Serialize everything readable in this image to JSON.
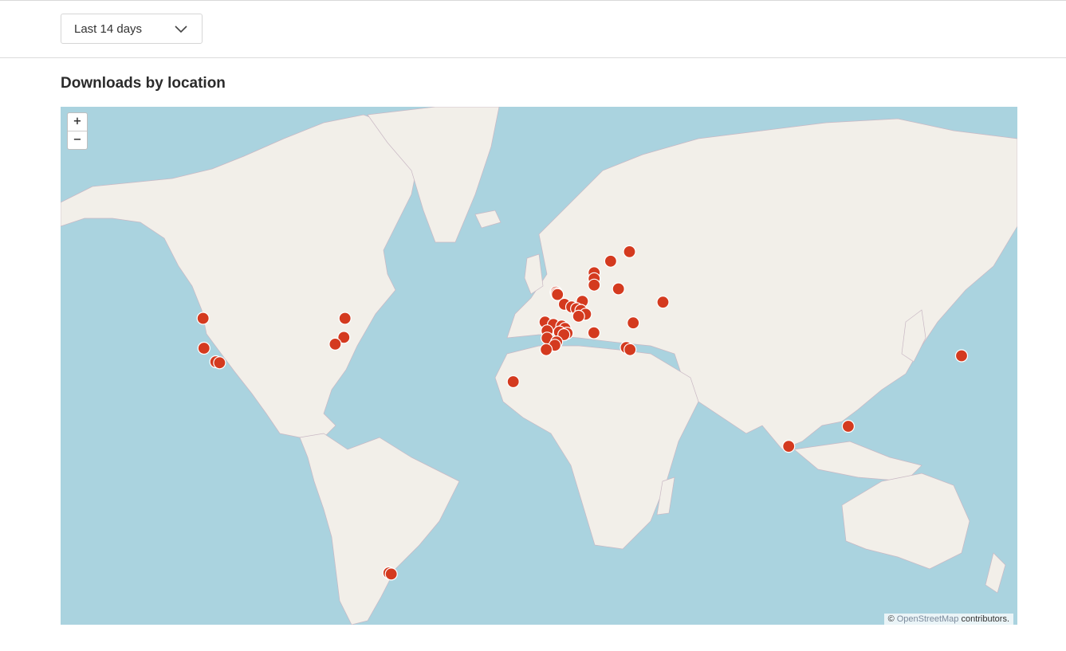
{
  "filter": {
    "selected_label": "Last 14 days",
    "chevron_icon": "chevron-down-icon"
  },
  "section": {
    "title": "Downloads by location"
  },
  "map": {
    "zoom_in_label": "+",
    "zoom_out_label": "−",
    "attribution": {
      "prefix": "©",
      "link_text": "OpenStreetMap",
      "suffix": "contributors."
    },
    "colors": {
      "water": "#aad3df",
      "land": "#f2efe9",
      "marker": "#d43a1f"
    },
    "locations": [
      {
        "lat": 49.3,
        "lon": 36.4
      },
      {
        "lat": 59.4,
        "lon": 24.8
      },
      {
        "lat": 57.7,
        "lon": 18.3
      },
      {
        "lat": 55.5,
        "lon": 12.6
      },
      {
        "lat": 54.3,
        "lon": 12.6
      },
      {
        "lat": 53.0,
        "lon": 12.6
      },
      {
        "lat": 52.2,
        "lon": 21.0
      },
      {
        "lat": 51.5,
        "lon": -0.6
      },
      {
        "lat": 51.2,
        "lon": -0.4
      },
      {
        "lat": 51.0,
        "lon": -0.1
      },
      {
        "lat": 49.5,
        "lon": 8.5
      },
      {
        "lat": 48.8,
        "lon": 2.3
      },
      {
        "lat": 48.2,
        "lon": 4.8
      },
      {
        "lat": 47.8,
        "lon": 6.5
      },
      {
        "lat": 47.4,
        "lon": 8.0
      },
      {
        "lat": 46.5,
        "lon": 9.6
      },
      {
        "lat": 46.0,
        "lon": 7.2
      },
      {
        "lat": 44.6,
        "lon": -4.4
      },
      {
        "lat": 44.0,
        "lon": -1.5
      },
      {
        "lat": 43.6,
        "lon": 1.4
      },
      {
        "lat": 43.0,
        "lon": 2.5
      },
      {
        "lat": 42.4,
        "lon": -3.7
      },
      {
        "lat": 42.1,
        "lon": 0.6
      },
      {
        "lat": 41.8,
        "lon": 3.2
      },
      {
        "lat": 41.4,
        "lon": 2.1
      },
      {
        "lat": 40.5,
        "lon": -3.7
      },
      {
        "lat": 39.5,
        "lon": -0.4
      },
      {
        "lat": 38.6,
        "lon": -1.0
      },
      {
        "lat": 37.4,
        "lon": -4.0
      },
      {
        "lat": 41.9,
        "lon": 12.5
      },
      {
        "lat": 44.4,
        "lon": 26.1
      },
      {
        "lat": 38.0,
        "lon": 23.7
      },
      {
        "lat": 37.4,
        "lon": 25.0
      },
      {
        "lat": 28.1,
        "lon": -15.4
      },
      {
        "lat": 6.9,
        "lon": 79.9
      },
      {
        "lat": 13.7,
        "lon": 100.5
      },
      {
        "lat": 35.7,
        "lon": 139.7
      },
      {
        "lat": 37.8,
        "lon": -122.4
      },
      {
        "lat": 34.0,
        "lon": -118.3
      },
      {
        "lat": 33.7,
        "lon": -117.0
      },
      {
        "lat": 45.5,
        "lon": -122.7
      },
      {
        "lat": 45.5,
        "lon": -73.6
      },
      {
        "lat": 40.7,
        "lon": -74.0
      },
      {
        "lat": 38.9,
        "lon": -77.0
      },
      {
        "lat": -34.6,
        "lon": -58.4
      },
      {
        "lat": -34.9,
        "lon": -57.6
      }
    ]
  }
}
